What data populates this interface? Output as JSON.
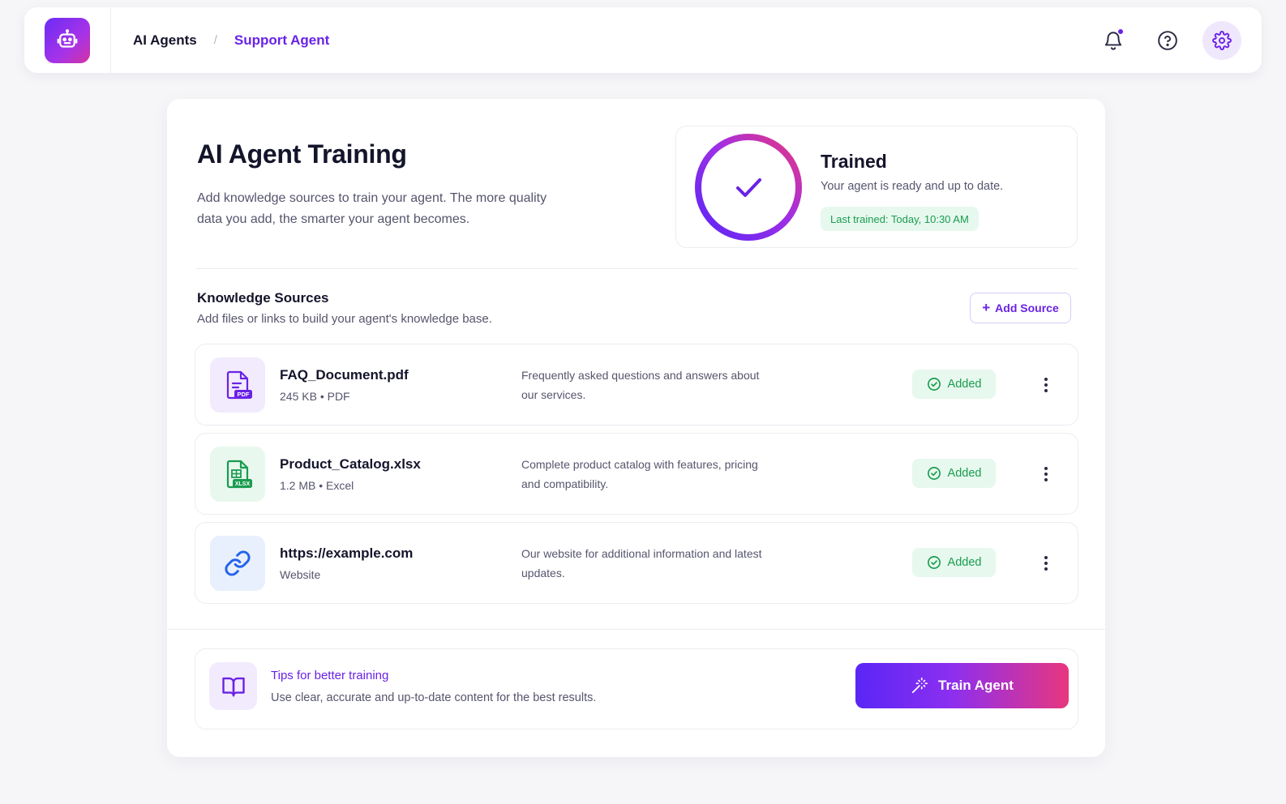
{
  "breadcrumb": {
    "root": "AI Agents",
    "separator": "/",
    "current": "Support Agent"
  },
  "header": {
    "title": "AI Agent Training",
    "description": "Add knowledge sources to train your agent. The more quality data you add, the smarter your agent becomes."
  },
  "status": {
    "title": "Trained",
    "description": "Your agent is ready and up to date.",
    "last_trained": "Last trained: Today, 10:30 AM",
    "progress": 1.0
  },
  "knowledge": {
    "title": "Knowledge Sources",
    "subtitle": "Add files or links to build your agent's knowledge base.",
    "add_label": "Add Source",
    "sources": [
      {
        "name": "FAQ_Document.pdf",
        "meta": "245 KB • PDF",
        "description": "Frequently asked questions and answers about our services.",
        "status": "Added",
        "icon": "pdf-file-icon",
        "badge": "PDF"
      },
      {
        "name": "Product_Catalog.xlsx",
        "meta": "1.2 MB • Excel",
        "description": "Complete product catalog with features, pricing and compatibility.",
        "status": "Added",
        "icon": "xlsx-file-icon",
        "badge": "XLSX"
      },
      {
        "name": "https://example.com",
        "meta": "Website",
        "description": "Our website for additional information and latest updates.",
        "status": "Added",
        "icon": "link-icon"
      }
    ]
  },
  "tips": {
    "title": "Tips for better training",
    "text": "Use clear, accurate and up-to-date content for the best results."
  },
  "actions": {
    "train_label": "Train Agent"
  },
  "colors": {
    "accent": "#6a22e6",
    "success": "#1a9c4f",
    "gradient_start": "#5a26f5",
    "gradient_end": "#e8367f"
  }
}
